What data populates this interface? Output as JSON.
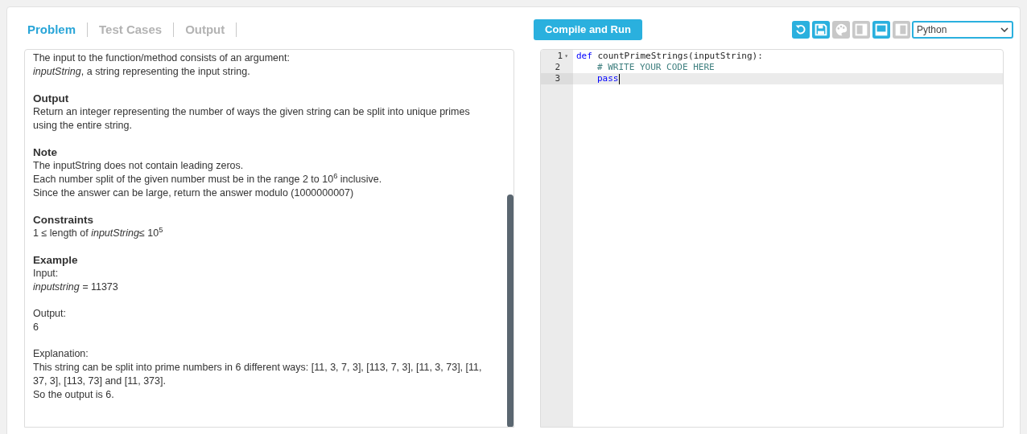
{
  "tabs": [
    {
      "label": "Problem",
      "selected": true
    },
    {
      "label": "Test Cases",
      "selected": false
    },
    {
      "label": "Output",
      "selected": false
    }
  ],
  "run_button": "Compile and Run",
  "toolbar": [
    {
      "kind": "reset",
      "enabled": true
    },
    {
      "kind": "save",
      "enabled": true
    },
    {
      "kind": "theme",
      "enabled": false
    },
    {
      "kind": "panel-right",
      "enabled": false
    },
    {
      "kind": "panel-bottom",
      "enabled": true
    },
    {
      "kind": "panel-left",
      "enabled": false
    }
  ],
  "language_select": {
    "value": "Python"
  },
  "problem": [
    {
      "lines": [
        "The input to the function/method consists of an argument:",
        "*inputString*, a string representing the input string."
      ]
    },
    {
      "heading": "Output",
      "lines": [
        "Return an integer representing the number of ways the given string can be split into unique primes using the entire string."
      ]
    },
    {
      "heading": "Note",
      "lines": [
        "The inputString does not contain leading zeros.",
        "Each number split of the given number must be in the range 2 to 10$^{6}$ inclusive.",
        "Since the answer can be large, return the answer modulo (1000000007)"
      ]
    },
    {
      "heading": "Constraints",
      "lines": [
        "1 ≤ length of *inputString*≤ 10$^{5}$"
      ]
    },
    {
      "heading": "Example",
      "lines": [
        "Input:",
        "*inputstring =* 11373"
      ]
    },
    {
      "lines": [
        "Output:",
        "6"
      ]
    },
    {
      "lines": [
        "Explanation:",
        "This string can be split into prime numbers in 6 different ways: [11, 3, 7, 3], [113, 7, 3], [11, 3, 73], [11, 37, 3], [113, 73] and [11, 373].",
        "So the output is 6."
      ]
    }
  ],
  "editor": [
    {
      "number": "1",
      "fold": "▾",
      "selected": false,
      "indent": false,
      "tokens": [
        {
          "kind": "keyword",
          "text": "def"
        },
        {
          "kind": "text",
          "text": " countPrimeStrings(inputString):"
        }
      ]
    },
    {
      "number": "2",
      "selected": false,
      "indent": true,
      "tokens": [
        {
          "kind": "comment",
          "text": "# WRITE YOUR CODE HERE"
        }
      ]
    },
    {
      "number": "3",
      "selected": true,
      "indent": true,
      "tokens": [
        {
          "kind": "keyword",
          "text": "pass"
        }
      ]
    }
  ]
}
